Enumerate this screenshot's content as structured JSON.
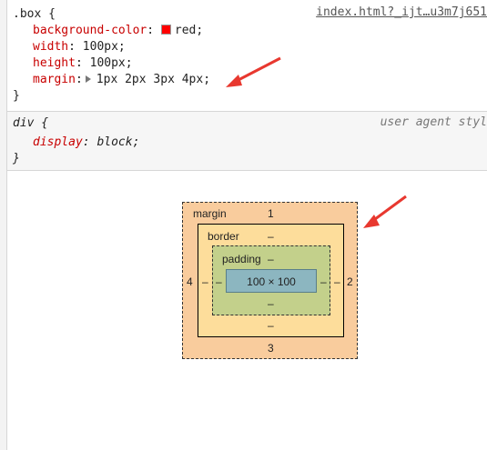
{
  "rule1": {
    "selector": ".box {",
    "declarations": [
      {
        "prop": "background-color",
        "value": "red;"
      },
      {
        "prop": "width",
        "value": "100px;"
      },
      {
        "prop": "height",
        "value": "100px;"
      },
      {
        "prop": "margin",
        "value": "1px 2px 3px 4px;"
      }
    ],
    "close": "}",
    "source": "index.html?_ijt…u3m7j651"
  },
  "rule2": {
    "selector": "div {",
    "declarations": [
      {
        "prop": "display",
        "value": "block;"
      }
    ],
    "close": "}",
    "source": "user agent styl"
  },
  "box_model": {
    "margin_label": "margin",
    "margin_top": "1",
    "margin_right": "2",
    "margin_bottom": "3",
    "margin_left": "4",
    "border_label": "border",
    "border_top": "–",
    "border_right": "–",
    "border_bottom": "–",
    "border_left": "–",
    "padding_label": "padding",
    "padding_top": "–",
    "padding_right": "–",
    "padding_bottom": "–",
    "padding_left": "–",
    "content": "100 × 100"
  },
  "colors": {
    "swatch": "#ff0000",
    "arrow": "#e8382f",
    "margin_bg": "#f9cc9d",
    "border_bg": "#fddd9b",
    "padding_bg": "#c3d08b",
    "content_bg": "#8cb6c0"
  }
}
